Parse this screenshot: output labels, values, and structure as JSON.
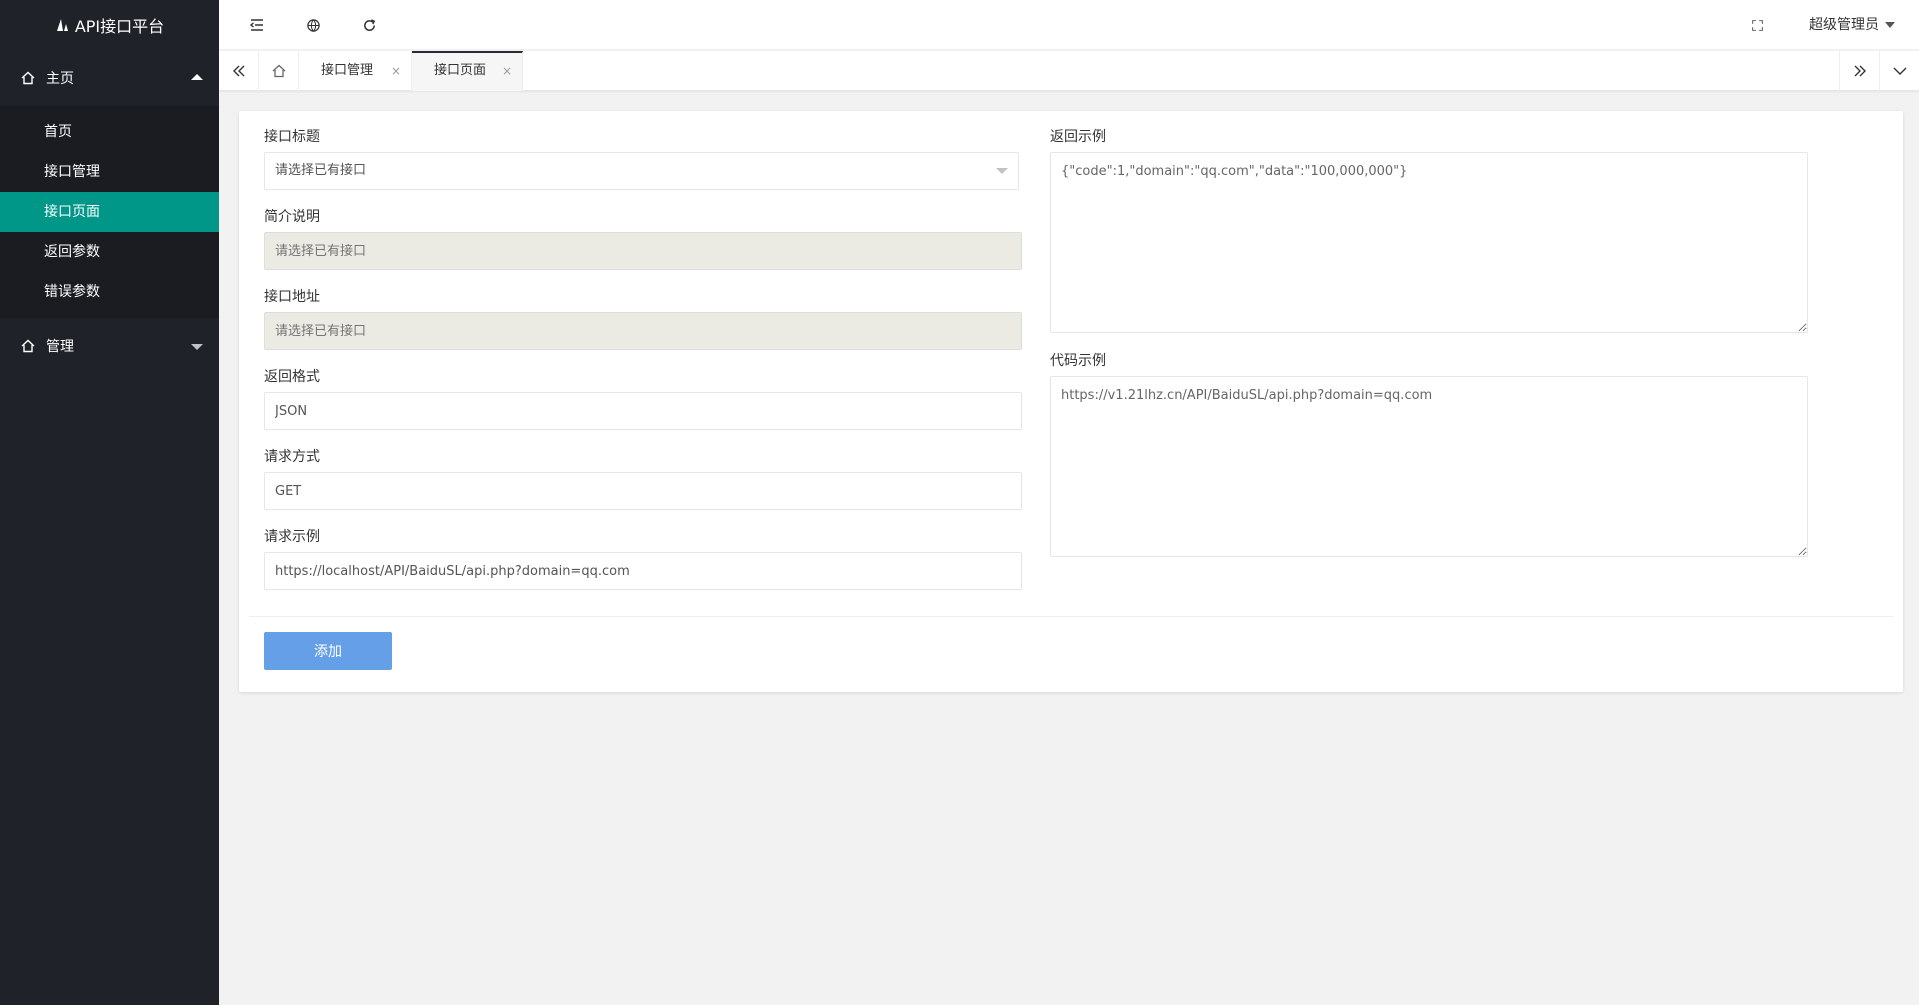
{
  "app": {
    "title": "API接口平台"
  },
  "sidebar": {
    "groups": [
      {
        "label": "主页",
        "expanded": true,
        "items": [
          {
            "label": "首页",
            "active": false
          },
          {
            "label": "接口管理",
            "active": false
          },
          {
            "label": "接口页面",
            "active": true
          },
          {
            "label": "返回参数",
            "active": false
          },
          {
            "label": "错误参数",
            "active": false
          }
        ]
      },
      {
        "label": "管理",
        "expanded": false,
        "items": []
      }
    ]
  },
  "header": {
    "icons": [
      "menu-fold-icon",
      "globe-icon",
      "refresh-icon",
      "fullscreen-icon"
    ],
    "user": "超级管理员"
  },
  "tabs": {
    "items": [
      {
        "label": "接口管理",
        "close": "×",
        "active": false
      },
      {
        "label": "接口页面",
        "close": "×",
        "active": true
      }
    ]
  },
  "form": {
    "title": {
      "label": "接口标题",
      "value": "请选择已有接口"
    },
    "desc": {
      "label": "简介说明",
      "placeholder": "请选择已有接口"
    },
    "url": {
      "label": "接口地址",
      "placeholder": "请选择已有接口"
    },
    "format": {
      "label": "返回格式",
      "value": "JSON"
    },
    "method": {
      "label": "请求方式",
      "value": "GET"
    },
    "request_example": {
      "label": "请求示例",
      "value": "https://localhost/API/BaiduSL/api.php?domain=qq.com"
    },
    "return_example": {
      "label": "返回示例",
      "value": "{\"code\":1,\"domain\":\"qq.com\",\"data\":\"100,000,000\"}"
    },
    "code_example": {
      "label": "代码示例",
      "value": "https://v1.21lhz.cn/API/BaiduSL/api.php?domain=qq.com"
    },
    "submit_label": "添加"
  },
  "colors": {
    "sidebar_bg": "#20222a",
    "active_item": "#009688",
    "primary_button": "#5d9ae6",
    "disabled_input": "#ebebe4"
  }
}
